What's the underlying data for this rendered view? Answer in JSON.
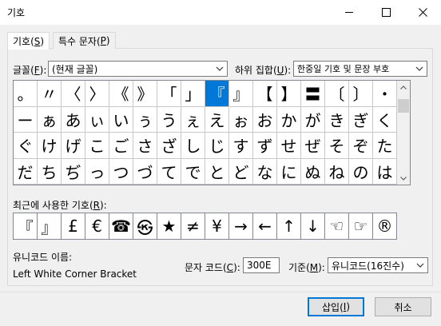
{
  "title": "기호",
  "window_controls": {
    "minimize": "—",
    "maximize": "☐",
    "close": "✕"
  },
  "tabs": [
    {
      "label": "기호(",
      "key": "S",
      "suffix": ")"
    },
    {
      "label": "특수 문자(",
      "key": "P",
      "suffix": ")"
    }
  ],
  "font": {
    "label_pre": "글꼴(",
    "key": "F",
    "label_post": "):",
    "value": "(현재 글꼴)"
  },
  "subset": {
    "label_pre": "하위 집합(",
    "key": "U",
    "label_post": "):",
    "value": "한중일 기호 및 문장 부호"
  },
  "grid_rows": [
    [
      "。",
      "〃",
      "〈",
      "〉",
      "《",
      "》",
      "「",
      "」",
      "『",
      "』",
      "【",
      "】",
      "〓",
      "〔",
      "〕",
      "・"
    ],
    [
      "ー",
      "ぁ",
      "あ",
      "ぃ",
      "い",
      "ぅ",
      "う",
      "ぇ",
      "え",
      "ぉ",
      "お",
      "か",
      "が",
      "き",
      "ぎ",
      "く"
    ],
    [
      "ぐ",
      "け",
      "げ",
      "こ",
      "ご",
      "さ",
      "ざ",
      "し",
      "じ",
      "す",
      "ず",
      "せ",
      "ぜ",
      "そ",
      "ぞ",
      "た"
    ],
    [
      "だ",
      "ち",
      "ぢ",
      "っ",
      "つ",
      "づ",
      "て",
      "で",
      "と",
      "ど",
      "な",
      "に",
      "ぬ",
      "ね",
      "の",
      "は"
    ]
  ],
  "grid_display_overrides": {
    "0-0": "。",
    "1-0": "ː"
  },
  "selected_cell": "0-8",
  "recent": {
    "label_pre": "최근에 사용한 기호(",
    "key": "R",
    "label_post": "):",
    "items": [
      "『",
      "』",
      "£",
      "€",
      "☎",
      "㉿",
      "★",
      "≠",
      "¥",
      "→",
      "←",
      "↑",
      "↓",
      "☜",
      "☞",
      "®"
    ]
  },
  "unicode_name_label": "유니코드 이름:",
  "unicode_name": "Left White Corner Bracket",
  "char_code": {
    "label_pre": "문자 코드(",
    "key": "C",
    "label_post": "):",
    "value": "300E"
  },
  "basis": {
    "label_pre": "기준(",
    "key": "M",
    "label_post": "):",
    "value": "유니코드(16진수)"
  },
  "buttons": {
    "insert": {
      "pre": "삽입(",
      "key": "I",
      "post": ")"
    },
    "cancel": "취소"
  },
  "colors": {
    "selected_bg": "#0078d7",
    "default_border": "#0078d7"
  }
}
